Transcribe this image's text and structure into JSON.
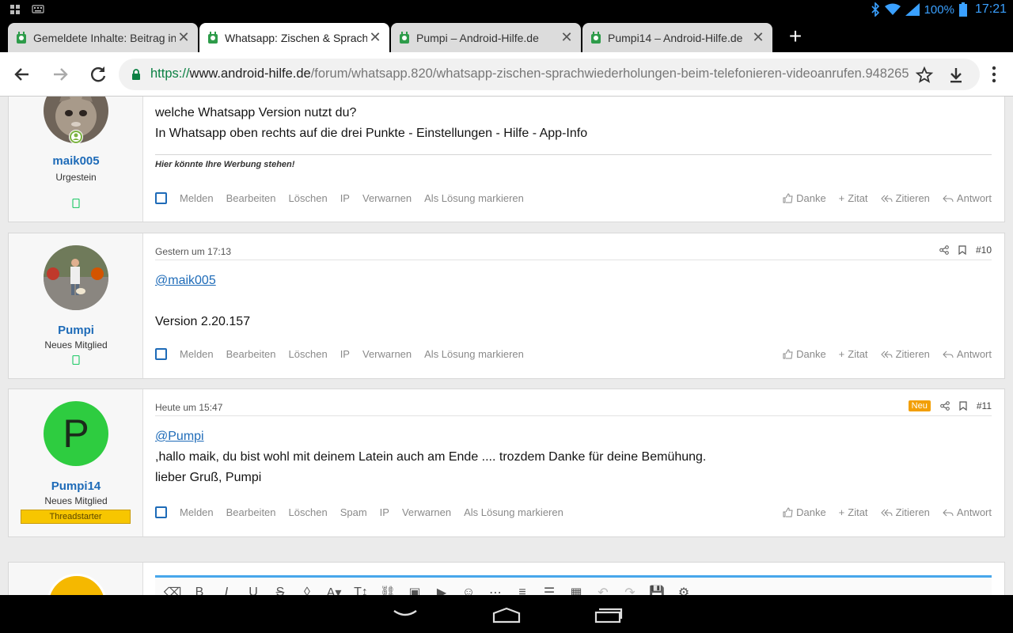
{
  "status_bar": {
    "battery": "100%",
    "time": "17:21"
  },
  "tabs": [
    {
      "title": "Gemeldete Inhalte: Beitrag in",
      "active": false
    },
    {
      "title": "Whatsapp: Zischen & Sprach",
      "active": true
    },
    {
      "title": "Pumpi – Android-Hilfe.de",
      "active": false
    },
    {
      "title": "Pumpi14 – Android-Hilfe.de",
      "active": false
    }
  ],
  "address_bar": {
    "scheme": "https://",
    "host": "www.android-hilfe.de",
    "path": "/forum/whatsapp.820/whatsapp-zischen-sprachwiederholungen-beim-telefonieren-videoanrufen.948265"
  },
  "posts": [
    {
      "username": "maik005",
      "user_title": "Urgestein",
      "lines": [
        "welche Whatsapp Version nutzt du?",
        "In Whatsapp oben rechts auf die drei Punkte - Einstellungen - Hilfe - App-Info"
      ],
      "signature": "Hier könnte Ihre Werbung stehen!",
      "actions_left": [
        "Melden",
        "Bearbeiten",
        "Löschen",
        "IP",
        "Verwarnen",
        "Als Lösung markieren"
      ],
      "actions_right": [
        "Danke",
        "Zitat",
        "Zitieren",
        "Antwort"
      ]
    },
    {
      "date": "Gestern um 17:13",
      "number": "#10",
      "username": "Pumpi",
      "user_title": "Neues Mitglied",
      "mention": "@maik005",
      "lines": [
        "Version 2.20.157"
      ],
      "actions_left": [
        "Melden",
        "Bearbeiten",
        "Löschen",
        "IP",
        "Verwarnen",
        "Als Lösung markieren"
      ],
      "actions_right": [
        "Danke",
        "Zitat",
        "Zitieren",
        "Antwort"
      ]
    },
    {
      "date": "Heute um 15:47",
      "new_badge": "Neu",
      "number": "#11",
      "username": "Pumpi14",
      "avatar_letter": "P",
      "user_title": "Neues Mitglied",
      "user_badge": "Threadstarter",
      "mention": "@Pumpi",
      "lines": [
        ",hallo maik, du bist wohl mit deinem Latein auch am Ende .... trozdem Danke für deine Bemühung.",
        "lieber Gruß, Pumpi"
      ],
      "actions_left": [
        "Melden",
        "Bearbeiten",
        "Löschen",
        "Spam",
        "IP",
        "Verwarnen",
        "Als Lösung markieren"
      ],
      "actions_right": [
        "Danke",
        "Zitat",
        "Zitieren",
        "Antwort"
      ]
    }
  ],
  "colors": {
    "link": "#1e6bb8",
    "avatar_green": "#2ecc40",
    "threadstarter": "#f7c600",
    "new_badge": "#f29f05",
    "editor_accent": "#47a7eb"
  }
}
